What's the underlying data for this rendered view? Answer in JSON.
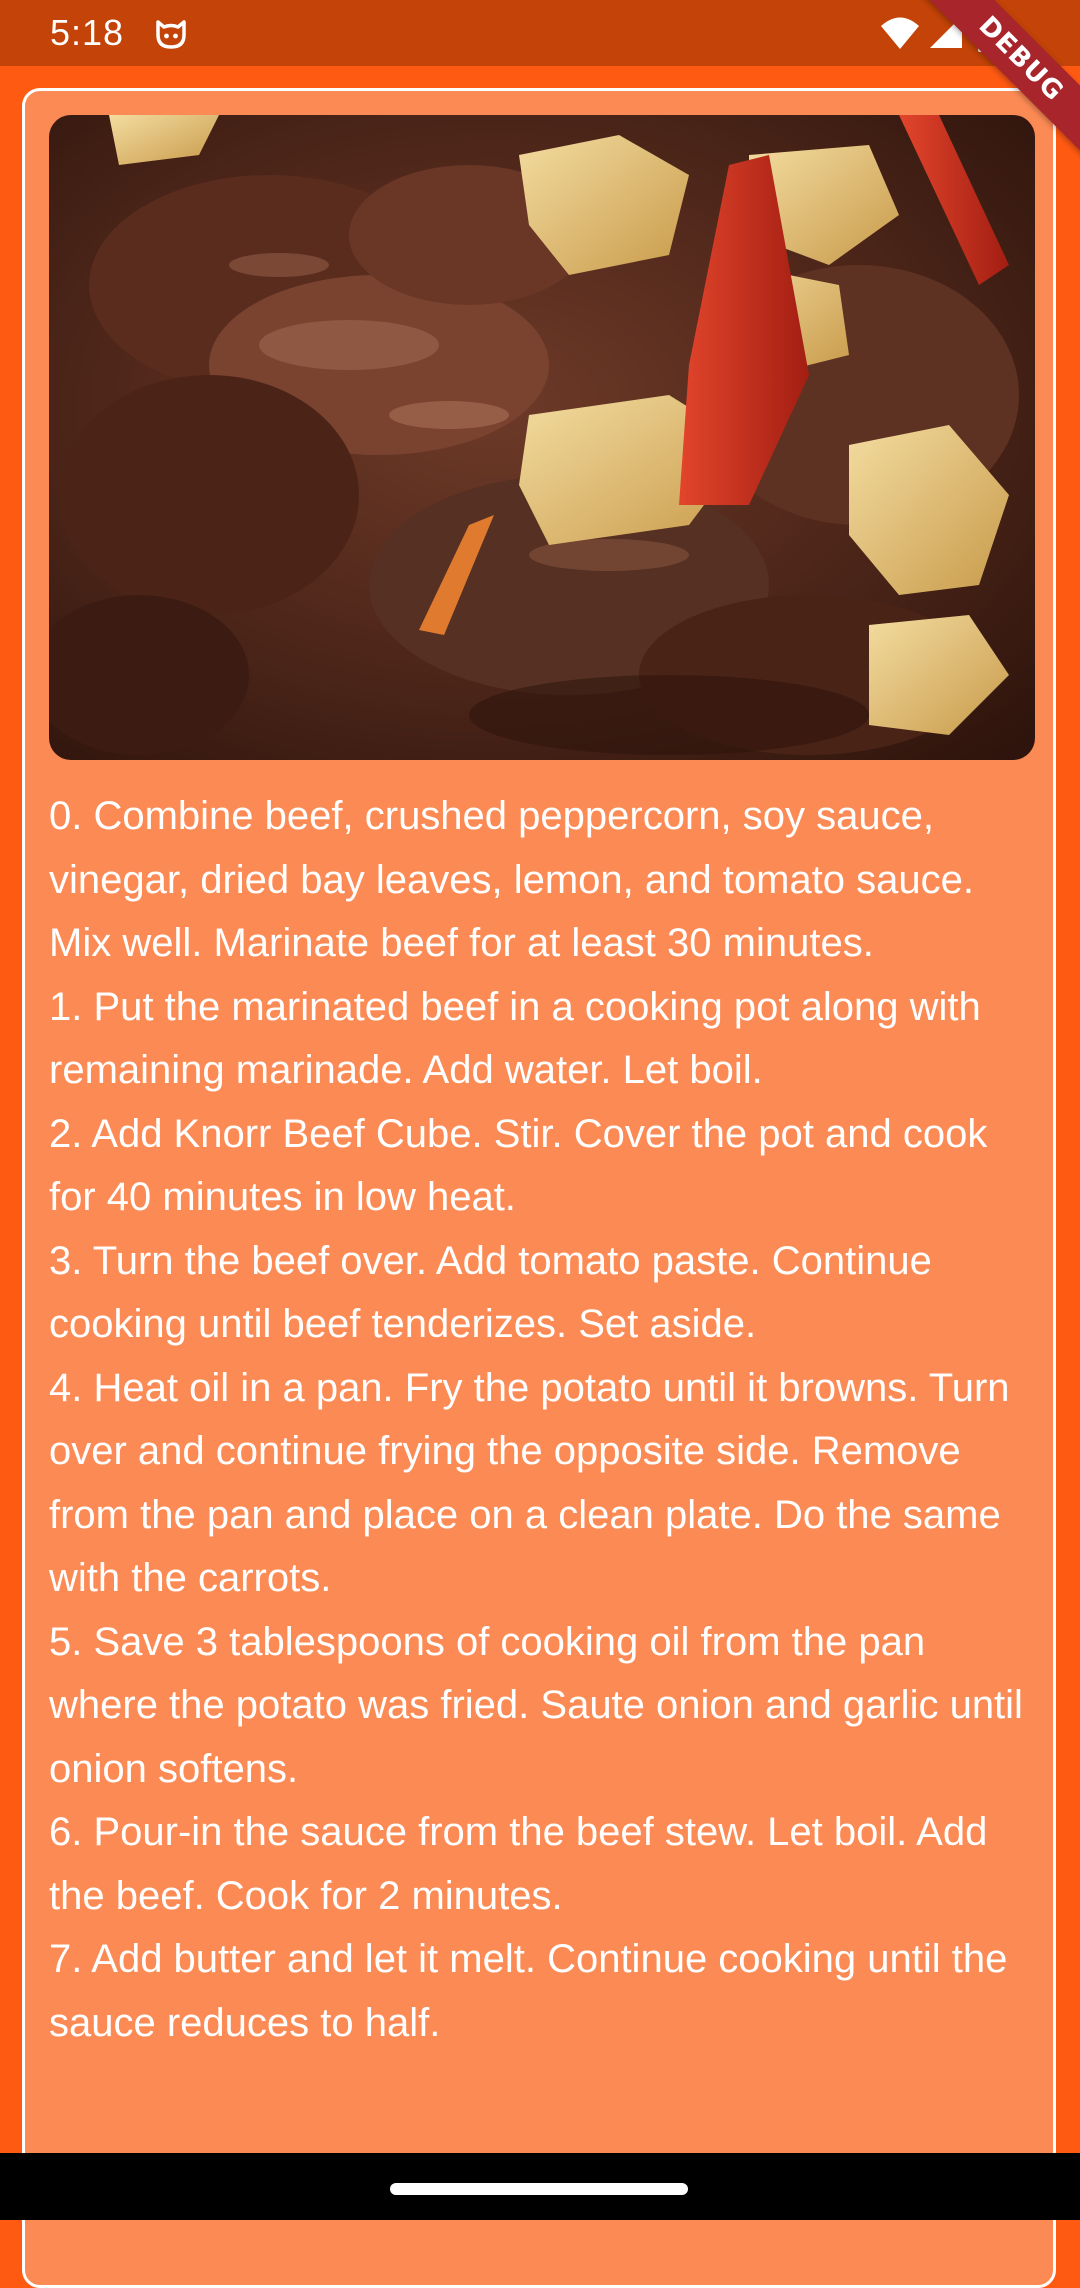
{
  "status_bar": {
    "time": "5:18",
    "app_icon": "cat-face-icon",
    "wifi_icon": "wifi-icon",
    "signal_icon": "cellular-signal-icon",
    "battery_icon": "battery-icon"
  },
  "debug_banner": {
    "label": "DEBUG"
  },
  "recipe": {
    "image_description_icon": "recipe-photo",
    "steps": [
      "0. Combine beef, crushed peppercorn, soy sauce, vinegar, dried bay leaves, lemon, and tomato sauce. Mix well. Marinate beef for at least 30 minutes.",
      "1. Put the marinated beef in a cooking pot along with remaining marinade. Add water. Let boil.",
      "2. Add Knorr Beef Cube. Stir. Cover the pot and cook for 40 minutes in low heat.",
      "3. Turn the beef over. Add tomato paste. Continue cooking until beef tenderizes. Set aside.",
      "4. Heat oil in a pan. Fry the potato until it browns. Turn over and continue frying the opposite side. Remove from the pan and place on a clean plate. Do the same with the carrots.",
      "5. Save 3 tablespoons of cooking oil from the pan where the potato was fried. Saute onion and garlic until onion softens.",
      "6. Pour-in the sauce from the beef stew. Let boil. Add the beef. Cook for 2 minutes.",
      "7. Add butter and let it melt. Continue cooking until the sauce reduces to half."
    ]
  },
  "nav_bar": {
    "home_indicator": "home-pill"
  },
  "colors": {
    "status_bar": "#C44308",
    "background": "#FF5A12",
    "card": "#FC8A54",
    "card_border": "#FFFFFF",
    "text": "#FFFFFF",
    "debug_banner": "#A8262B"
  }
}
